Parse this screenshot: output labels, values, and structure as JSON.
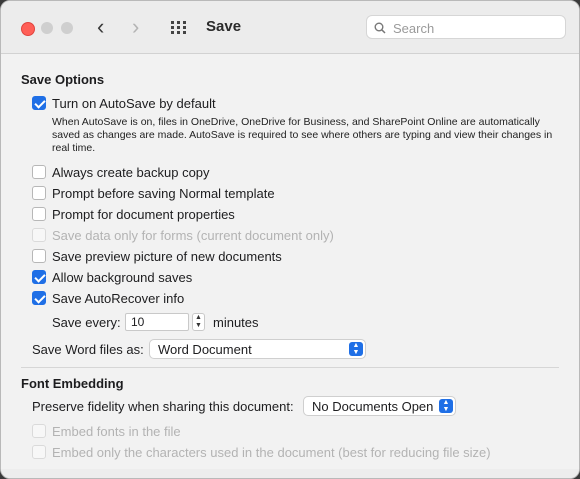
{
  "window": {
    "title": "Save"
  },
  "search": {
    "placeholder": "Search"
  },
  "save_options": {
    "heading": "Save Options",
    "autosave": {
      "label": "Turn on AutoSave by default",
      "checked": true,
      "description": "When AutoSave is on, files in OneDrive, OneDrive for Business, and SharePoint Online are automatically saved as changes are made. AutoSave is required to see where others are typing and view their changes in real time."
    },
    "options": [
      {
        "label": "Always create backup copy",
        "checked": false,
        "enabled": true
      },
      {
        "label": "Prompt before saving Normal template",
        "checked": false,
        "enabled": true
      },
      {
        "label": "Prompt for document properties",
        "checked": false,
        "enabled": true
      },
      {
        "label": "Save data only for forms (current document only)",
        "checked": false,
        "enabled": false
      },
      {
        "label": "Save preview picture of new documents",
        "checked": false,
        "enabled": true
      },
      {
        "label": "Allow background saves",
        "checked": true,
        "enabled": true
      },
      {
        "label": "Save AutoRecover info",
        "checked": true,
        "enabled": true
      }
    ],
    "save_every_label": "Save every:",
    "save_every_value": "10",
    "minutes_label": "minutes",
    "save_as_label": "Save Word files as:",
    "save_as_value": "Word Document"
  },
  "font_embedding": {
    "heading": "Font Embedding",
    "preserve_label": "Preserve fidelity when sharing this document:",
    "preserve_value": "No Documents Open",
    "options": [
      {
        "label": "Embed fonts in the file",
        "checked": false,
        "enabled": false
      },
      {
        "label": "Embed only the characters used in the document (best for reducing file size)",
        "checked": false,
        "enabled": false
      }
    ]
  },
  "colors": {
    "accent": "#1f6fe6",
    "close": "#ff5f57"
  },
  "icons": [
    "close-button",
    "back-icon",
    "forward-icon",
    "grid-icon",
    "search-icon",
    "stepper-icon",
    "popup-arrows-icon"
  ]
}
